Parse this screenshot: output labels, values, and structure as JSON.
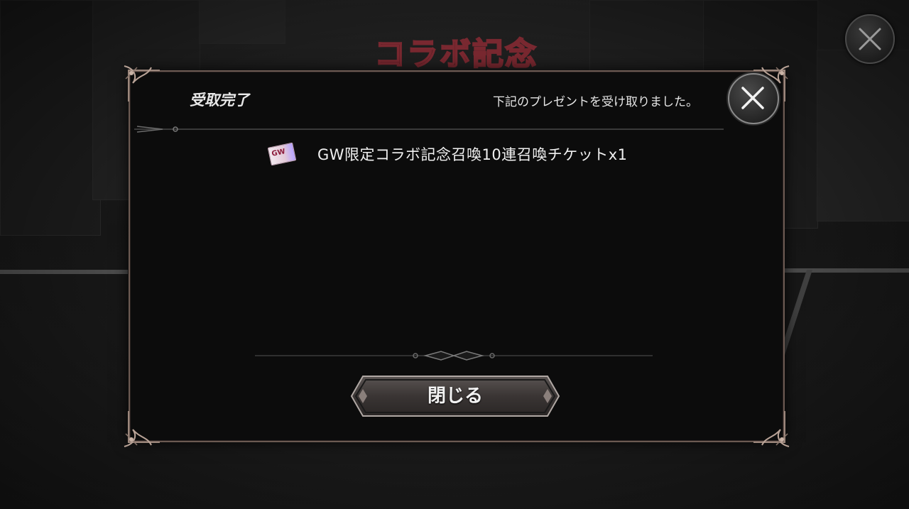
{
  "background": {
    "event_banner": "コラボ記念"
  },
  "dialog": {
    "title": "受取完了",
    "message": "下記のプレゼントを受け取りました。",
    "rewards": [
      {
        "icon": "gw-ticket-icon",
        "icon_text": "GW",
        "label": "GW限定コラボ記念召喚10連召喚チケットx1"
      }
    ],
    "close_button_label": "閉じる"
  },
  "colors": {
    "frame": "#6b5a52",
    "panel": "#0c0c0c",
    "text": "#f0f0f0"
  }
}
